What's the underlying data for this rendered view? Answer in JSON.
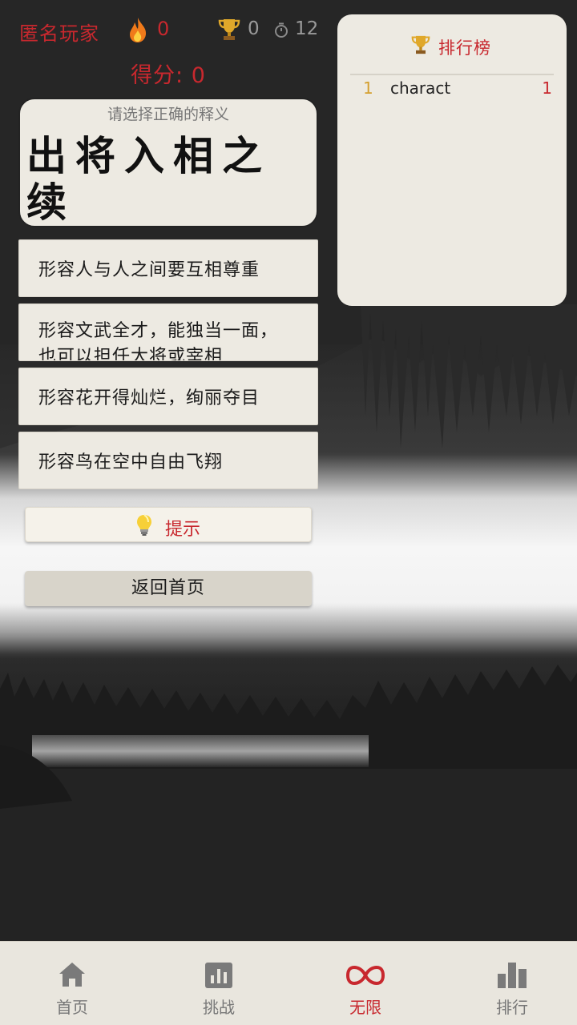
{
  "status": {
    "player_name": "匿名玩家",
    "streak": "0",
    "trophies": "0",
    "timer": "12",
    "score_label": "得分: 0"
  },
  "question": {
    "prompt": "请选择正确的释义",
    "idiom": "出将入相之续"
  },
  "options": [
    {
      "label": "形容人与人之间要互相尊重"
    },
    {
      "label": "形容文武全才，能独当一面，也可以担任大将或宰相"
    },
    {
      "label": "形容花开得灿烂，绚丽夺目"
    },
    {
      "label": "形容鸟在空中自由飞翔"
    }
  ],
  "actions": {
    "hint_label": "提示",
    "home_label": "返回首页"
  },
  "leaderboard": {
    "title": "排行榜",
    "rows": [
      {
        "rank": "1",
        "name": "charact",
        "score": "1"
      }
    ]
  },
  "nav": [
    {
      "label": "首页",
      "icon": "home-icon"
    },
    {
      "label": "挑战",
      "icon": "chart-icon"
    },
    {
      "label": "无限",
      "icon": "infinity-icon",
      "active": true
    },
    {
      "label": "排行",
      "icon": "ranking-icon"
    }
  ],
  "colors": {
    "accent": "#c8282e",
    "card": "#edeae2",
    "gold": "#d4a030"
  }
}
